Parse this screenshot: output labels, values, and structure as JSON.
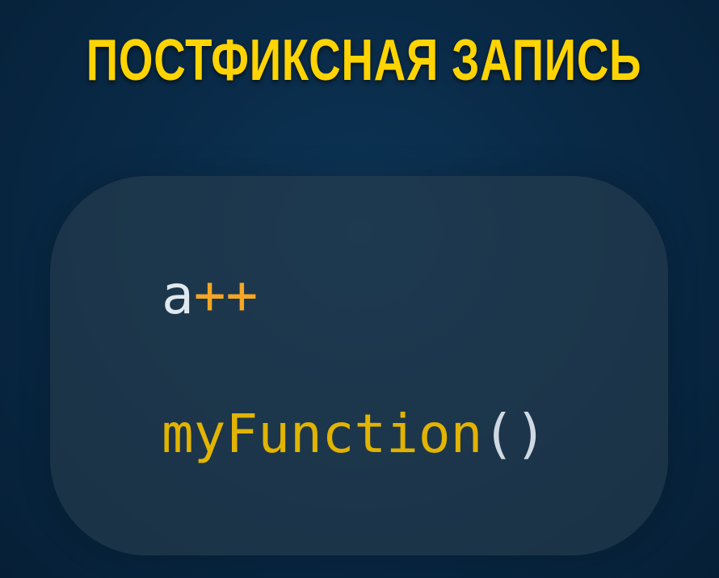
{
  "title": "ПОСТФИКСНАЯ ЗАПИСЬ",
  "code": {
    "line1": {
      "variable": "a",
      "operator": "++"
    },
    "line2": {
      "function": "myFunction",
      "parens": "()"
    }
  },
  "colors": {
    "title": "#ffd400",
    "background": "#092a47",
    "variable": "#dfe8ef",
    "operator": "#f5a623",
    "function": "#e2b400",
    "parens": "#cfd9e2"
  }
}
